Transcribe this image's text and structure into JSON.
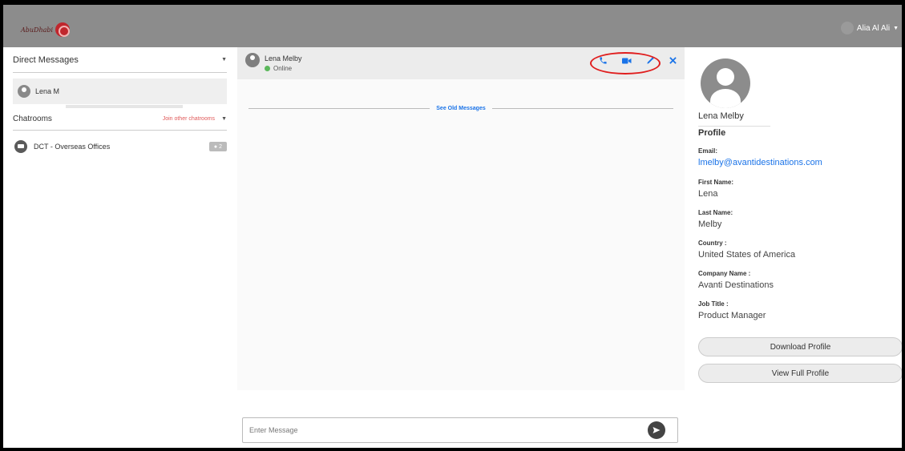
{
  "header": {
    "logo_text": "AbuDhabi",
    "user_name": "Alia Al Ali"
  },
  "sidebar": {
    "direct_messages_title": "Direct Messages",
    "direct_messages": [
      {
        "name": "Lena M"
      }
    ],
    "chatrooms_title": "Chatrooms",
    "join_other_label": "Join other chatrooms",
    "chatrooms": [
      {
        "name": "DCT - Overseas Offices",
        "member_count": "2"
      }
    ]
  },
  "chat": {
    "contact_name": "Lena Melby",
    "status": "Online",
    "see_old_messages": "See Old Messages",
    "input_placeholder": "Enter Message",
    "colors": {
      "online": "#5cb85c",
      "accent": "#1a73e8",
      "highlight": "#e01e1e"
    }
  },
  "profile": {
    "name": "Lena Melby",
    "section_title": "Profile",
    "fields": [
      {
        "label": "Email:",
        "value": "lmelby@avantidestinations.com"
      },
      {
        "label": "First Name:",
        "value": "Lena"
      },
      {
        "label": "Last Name:",
        "value": "Melby"
      },
      {
        "label": "Country :",
        "value": "United States of America"
      },
      {
        "label": "Company Name :",
        "value": "Avanti Destinations"
      },
      {
        "label": "Job Title :",
        "value": "Product Manager"
      }
    ],
    "download_button": "Download Profile",
    "view_button": "View Full Profile"
  }
}
